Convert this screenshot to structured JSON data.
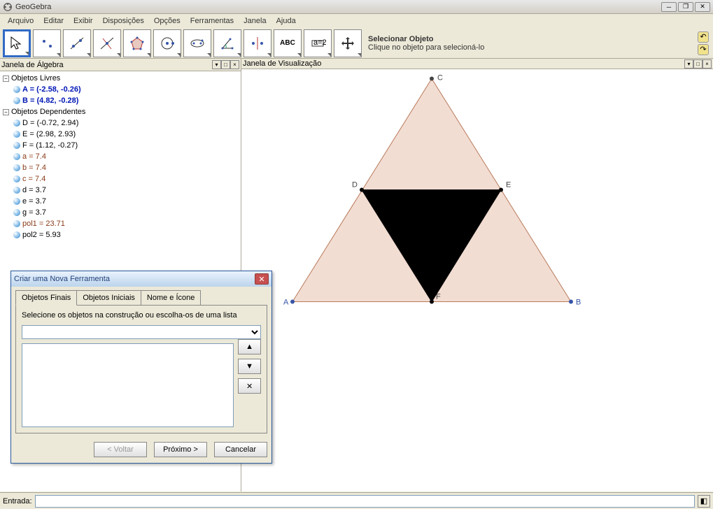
{
  "titlebar": {
    "title": "GeoGebra"
  },
  "menus": [
    "Arquivo",
    "Editar",
    "Exibir",
    "Disposições",
    "Opções",
    "Ferramentas",
    "Janela",
    "Ajuda"
  ],
  "tooltip": {
    "title": "Selecionar Objeto",
    "desc": "Clique no objeto para selecioná-lo"
  },
  "panel_left_title": "Janela de Álgebra",
  "panel_right_title": "Janela de Visualização",
  "tree": {
    "free_label": "Objetos Livres",
    "dep_label": "Objetos Dependentes",
    "free": [
      {
        "text": "A = (-2.58, -0.26)",
        "cls": "bluebold"
      },
      {
        "text": "B = (4.82, -0.28)",
        "cls": "bluebold"
      }
    ],
    "dep": [
      {
        "text": "D = (-0.72, 2.94)",
        "cls": ""
      },
      {
        "text": "E = (2.98, 2.93)",
        "cls": ""
      },
      {
        "text": "F = (1.12, -0.27)",
        "cls": ""
      },
      {
        "text": "a = 7.4",
        "cls": "darkred"
      },
      {
        "text": "b = 7.4",
        "cls": "darkred"
      },
      {
        "text": "c = 7.4",
        "cls": "darkred"
      },
      {
        "text": "d = 3.7",
        "cls": ""
      },
      {
        "text": "e = 3.7",
        "cls": ""
      },
      {
        "text": "g = 3.7",
        "cls": ""
      },
      {
        "text": "pol1 = 23.71",
        "cls": "darkred"
      },
      {
        "text": "pol2 = 5.93",
        "cls": ""
      }
    ]
  },
  "dialog": {
    "title": "Criar uma Nova Ferramenta",
    "tabs": [
      "Objetos Finais",
      "Objetos Iniciais",
      "Nome e Ícone"
    ],
    "instr": "Selecione os objetos na construção ou escolha-os de uma lista",
    "back": "< Voltar",
    "next": "Próximo >",
    "cancel": "Cancelar"
  },
  "entry_label": "Entrada:",
  "graphics": {
    "points": {
      "A": "A",
      "B": "B",
      "C": "C",
      "D": "D",
      "E": "E",
      "F": "F"
    }
  }
}
